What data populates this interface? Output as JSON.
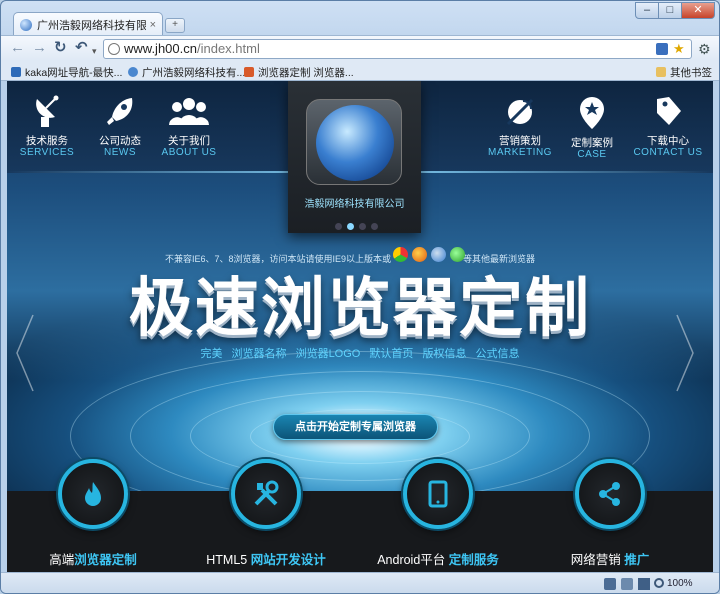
{
  "browser": {
    "tab_title": "广州浩毅网络科技有限公...",
    "tab_close": "×",
    "new_tab": "+",
    "window_buttons": {
      "minimize": "–",
      "maximize": "□",
      "close": "✕"
    },
    "url_host": "www.jh00.cn",
    "url_path": "/index.html",
    "bookmarks": [
      {
        "label": "kaka网址导航-最快..."
      },
      {
        "label": "广州浩毅网络科技有..."
      },
      {
        "label": "浏览器定制 浏览器..."
      }
    ],
    "other_bookmarks": "其他书签",
    "zoom": "100%"
  },
  "site": {
    "nav_left": [
      {
        "cn": "技术服务",
        "en": "SERVICES",
        "icon": "satellite-dish-icon"
      },
      {
        "cn": "公司动态",
        "en": "NEWS",
        "icon": "rocket-icon"
      },
      {
        "cn": "关于我们",
        "en": "ABOUT US",
        "icon": "people-icon"
      }
    ],
    "nav_right": [
      {
        "cn": "营销策划",
        "en": "MARKETING",
        "icon": "satellite-icon"
      },
      {
        "cn": "定制案例",
        "en": "CASE",
        "icon": "location-pin-icon"
      },
      {
        "cn": "下载中心",
        "en": "CONTACT US",
        "icon": "tag-icon"
      }
    ],
    "logo_name": "浩毅网络科技有限公司",
    "hint": "不兼容IE6、7、8浏览器，访问本站请使用IE9以上版本或",
    "hint_suffix": "等其他最新浏览器",
    "headline": "极速浏览器定制",
    "subtitle": "完美 浏览器名称 浏览器LOGO 默认首页 版权信息 公式信息",
    "cta": "点击开始定制专属浏览器",
    "features": [
      {
        "prefix": "高端",
        "bold": "浏览器定制",
        "icon": "flame-icon"
      },
      {
        "prefix": "HTML5 ",
        "bold": "网站开发设计",
        "icon": "tools-icon"
      },
      {
        "prefix": "Android平台 ",
        "bold": "定制服务",
        "icon": "tablet-icon"
      },
      {
        "prefix": "网络营销 ",
        "bold": "推广",
        "icon": "share-icon"
      }
    ]
  },
  "colors": {
    "accent": "#3ec6f4",
    "nav_en": "#5ac8f0",
    "dark": "#17191c"
  }
}
